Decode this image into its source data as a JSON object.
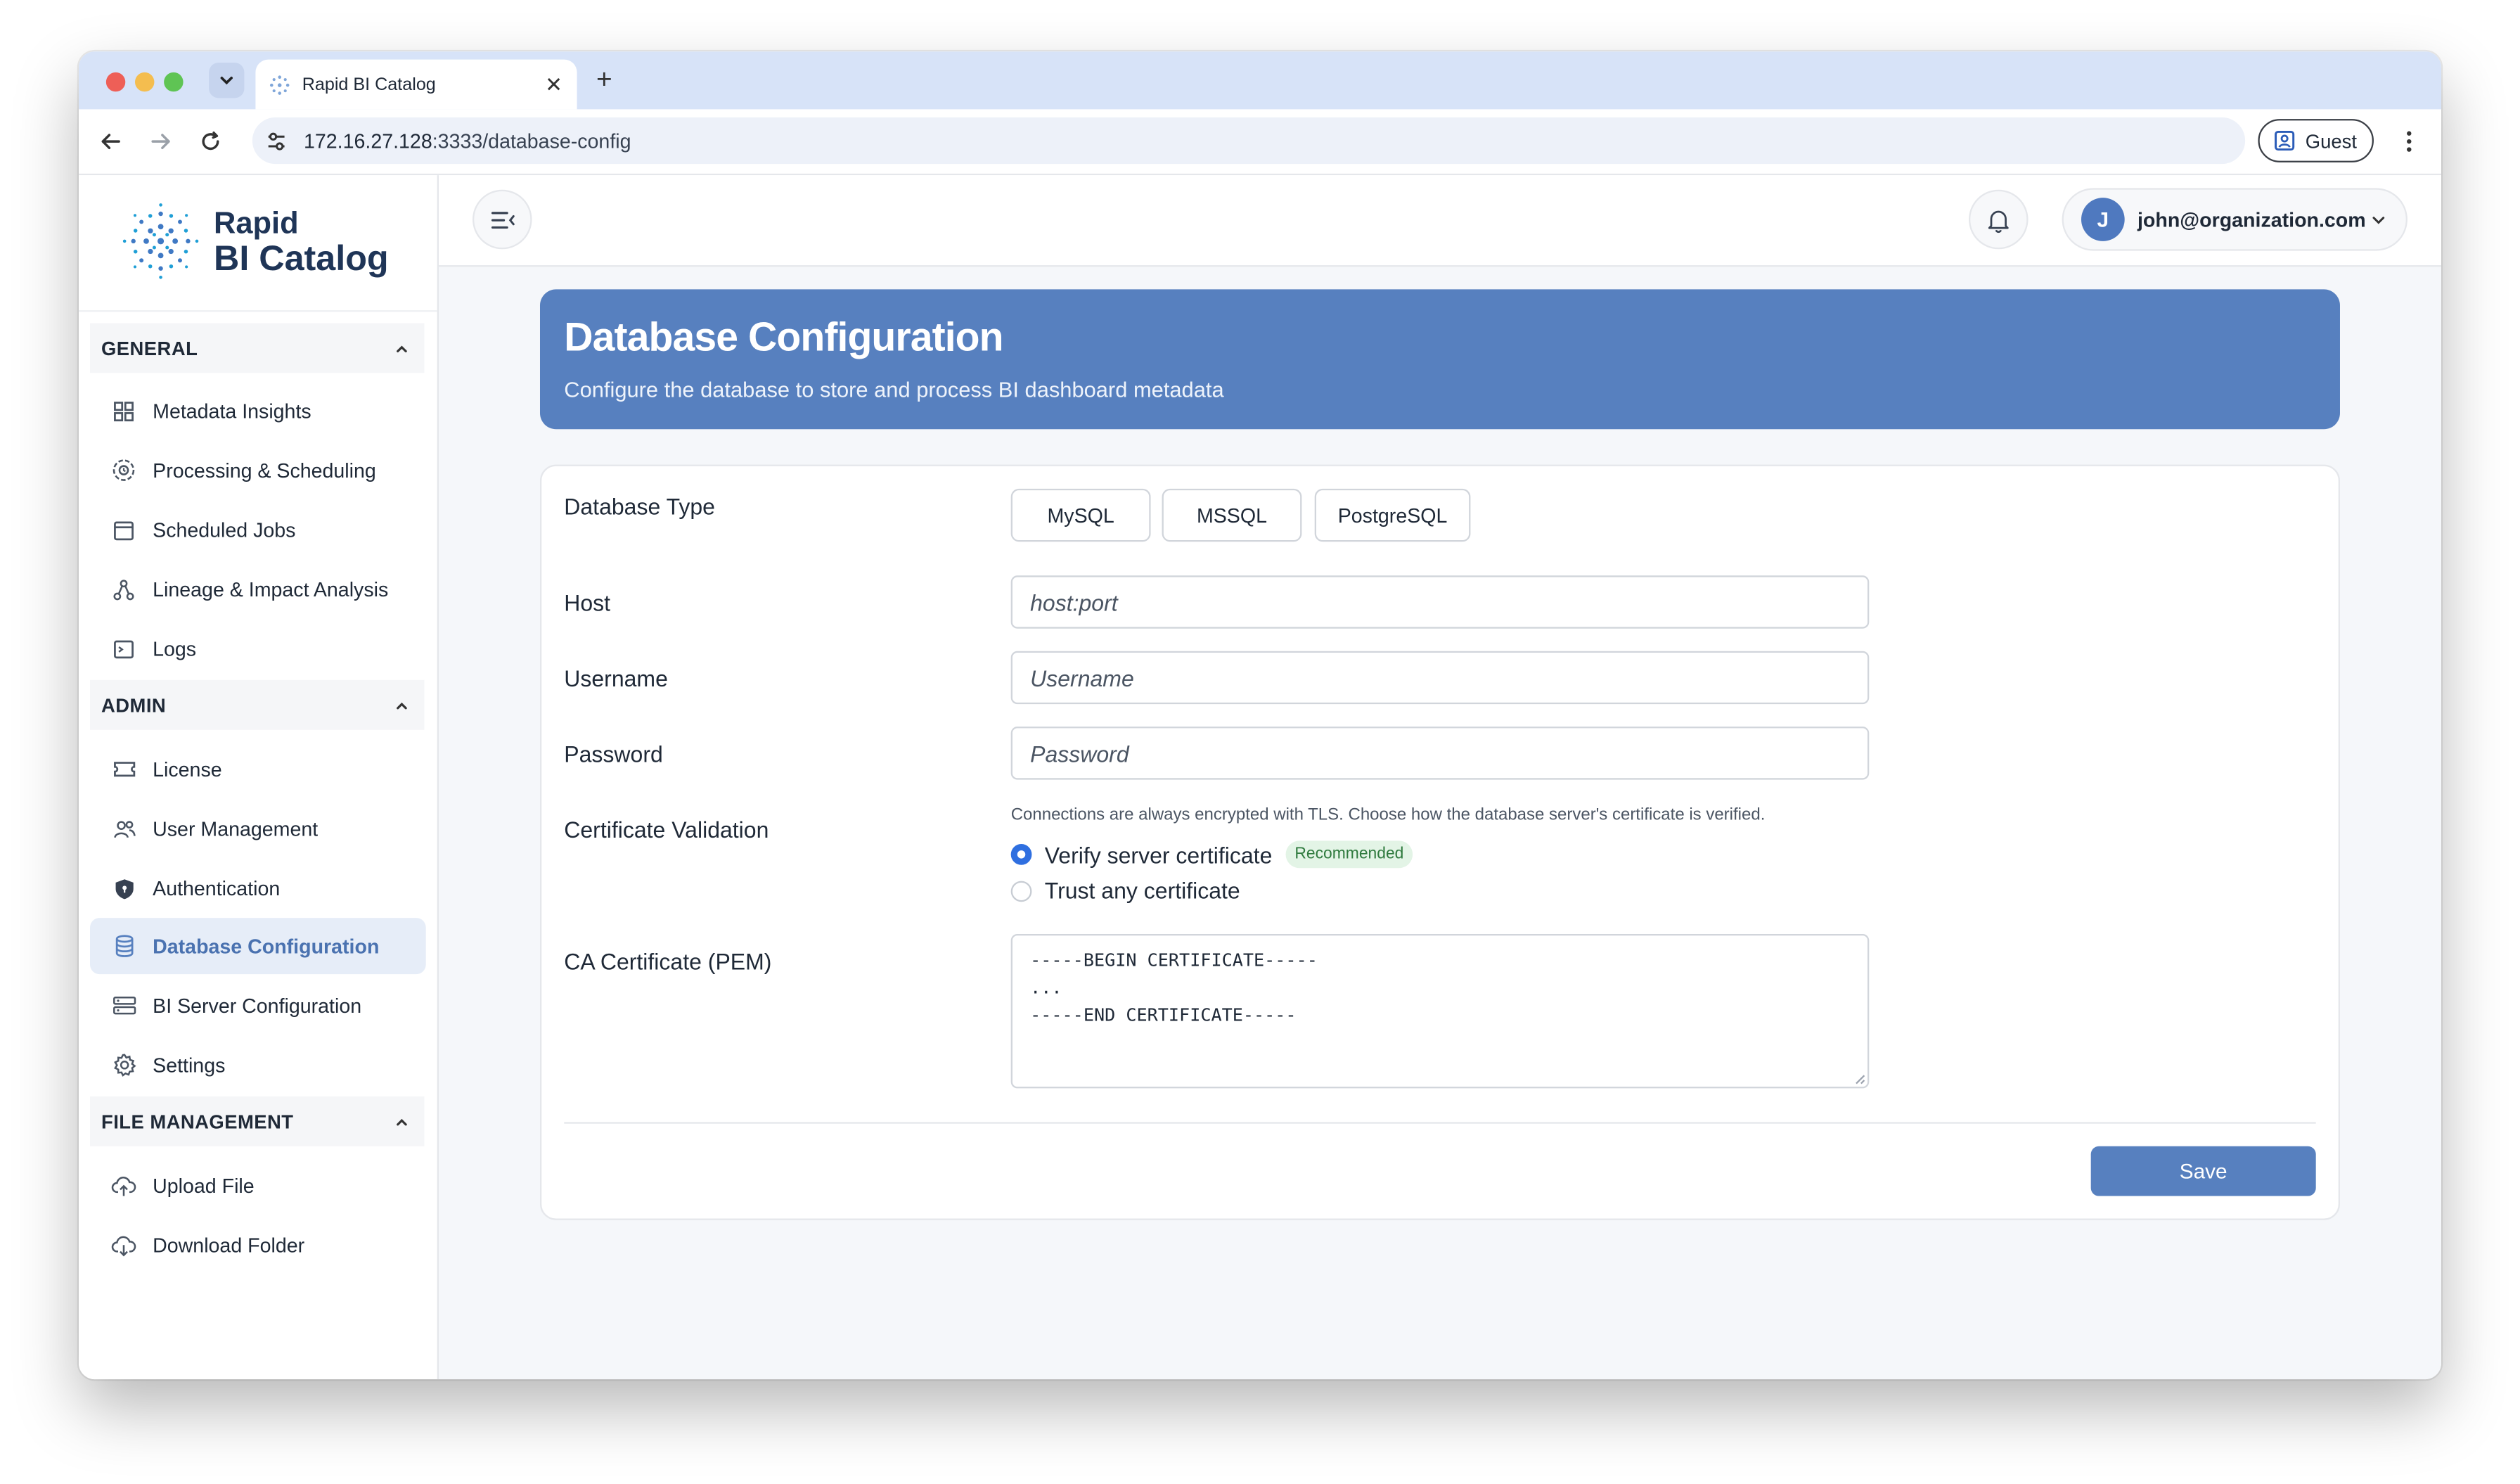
{
  "browser": {
    "tab_title": "Rapid BI Catalog",
    "url_host": "172.16.27.128",
    "url_rest": ":3333/database-config",
    "guest_label": "Guest"
  },
  "sidebar": {
    "logo_line1": "Rapid",
    "logo_line2": "BI Catalog",
    "sections": [
      {
        "title": "GENERAL",
        "items": [
          {
            "label": "Metadata Insights",
            "icon": "grid-icon"
          },
          {
            "label": "Processing & Scheduling",
            "icon": "cycle-icon"
          },
          {
            "label": "Scheduled Jobs",
            "icon": "calendar-icon"
          },
          {
            "label": "Lineage & Impact Analysis",
            "icon": "network-icon"
          },
          {
            "label": "Logs",
            "icon": "terminal-icon"
          }
        ]
      },
      {
        "title": "ADMIN",
        "items": [
          {
            "label": "License",
            "icon": "ticket-icon"
          },
          {
            "label": "User Management",
            "icon": "users-icon"
          },
          {
            "label": "Authentication",
            "icon": "shield-icon"
          },
          {
            "label": "Database Configuration",
            "icon": "database-icon",
            "active": true
          },
          {
            "label": "BI Server Configuration",
            "icon": "server-icon"
          },
          {
            "label": "Settings",
            "icon": "gear-icon"
          }
        ]
      },
      {
        "title": "FILE MANAGEMENT",
        "items": [
          {
            "label": "Upload File",
            "icon": "cloud-upload-icon"
          },
          {
            "label": "Download Folder",
            "icon": "cloud-download-icon"
          }
        ]
      }
    ]
  },
  "topbar": {
    "avatar_initial": "J",
    "user_email": "john@organization.com"
  },
  "page": {
    "title": "Database Configuration",
    "subtitle": "Configure the database to store and process BI dashboard metadata"
  },
  "form": {
    "db_type_label": "Database Type",
    "db_types": [
      "MySQL",
      "MSSQL",
      "PostgreSQL"
    ],
    "host_label": "Host",
    "host_placeholder": "host:port",
    "username_label": "Username",
    "username_placeholder": "Username",
    "password_label": "Password",
    "password_placeholder": "Password",
    "cert_label": "Certificate Validation",
    "cert_hint": "Connections are always encrypted with TLS. Choose how the database server's certificate is verified.",
    "cert_options": [
      {
        "label": "Verify server certificate",
        "selected": true,
        "badge": "Recommended"
      },
      {
        "label": "Trust any certificate",
        "selected": false
      }
    ],
    "ca_label": "CA Certificate (PEM)",
    "ca_placeholder": "-----BEGIN CERTIFICATE-----\n...\n-----END CERTIFICATE-----",
    "save_label": "Save"
  },
  "colors": {
    "accent": "#5780bf",
    "active_nav_bg": "#e6edf8",
    "radio_on": "#2f6fe0",
    "badge_bg": "#e3f4e6"
  }
}
